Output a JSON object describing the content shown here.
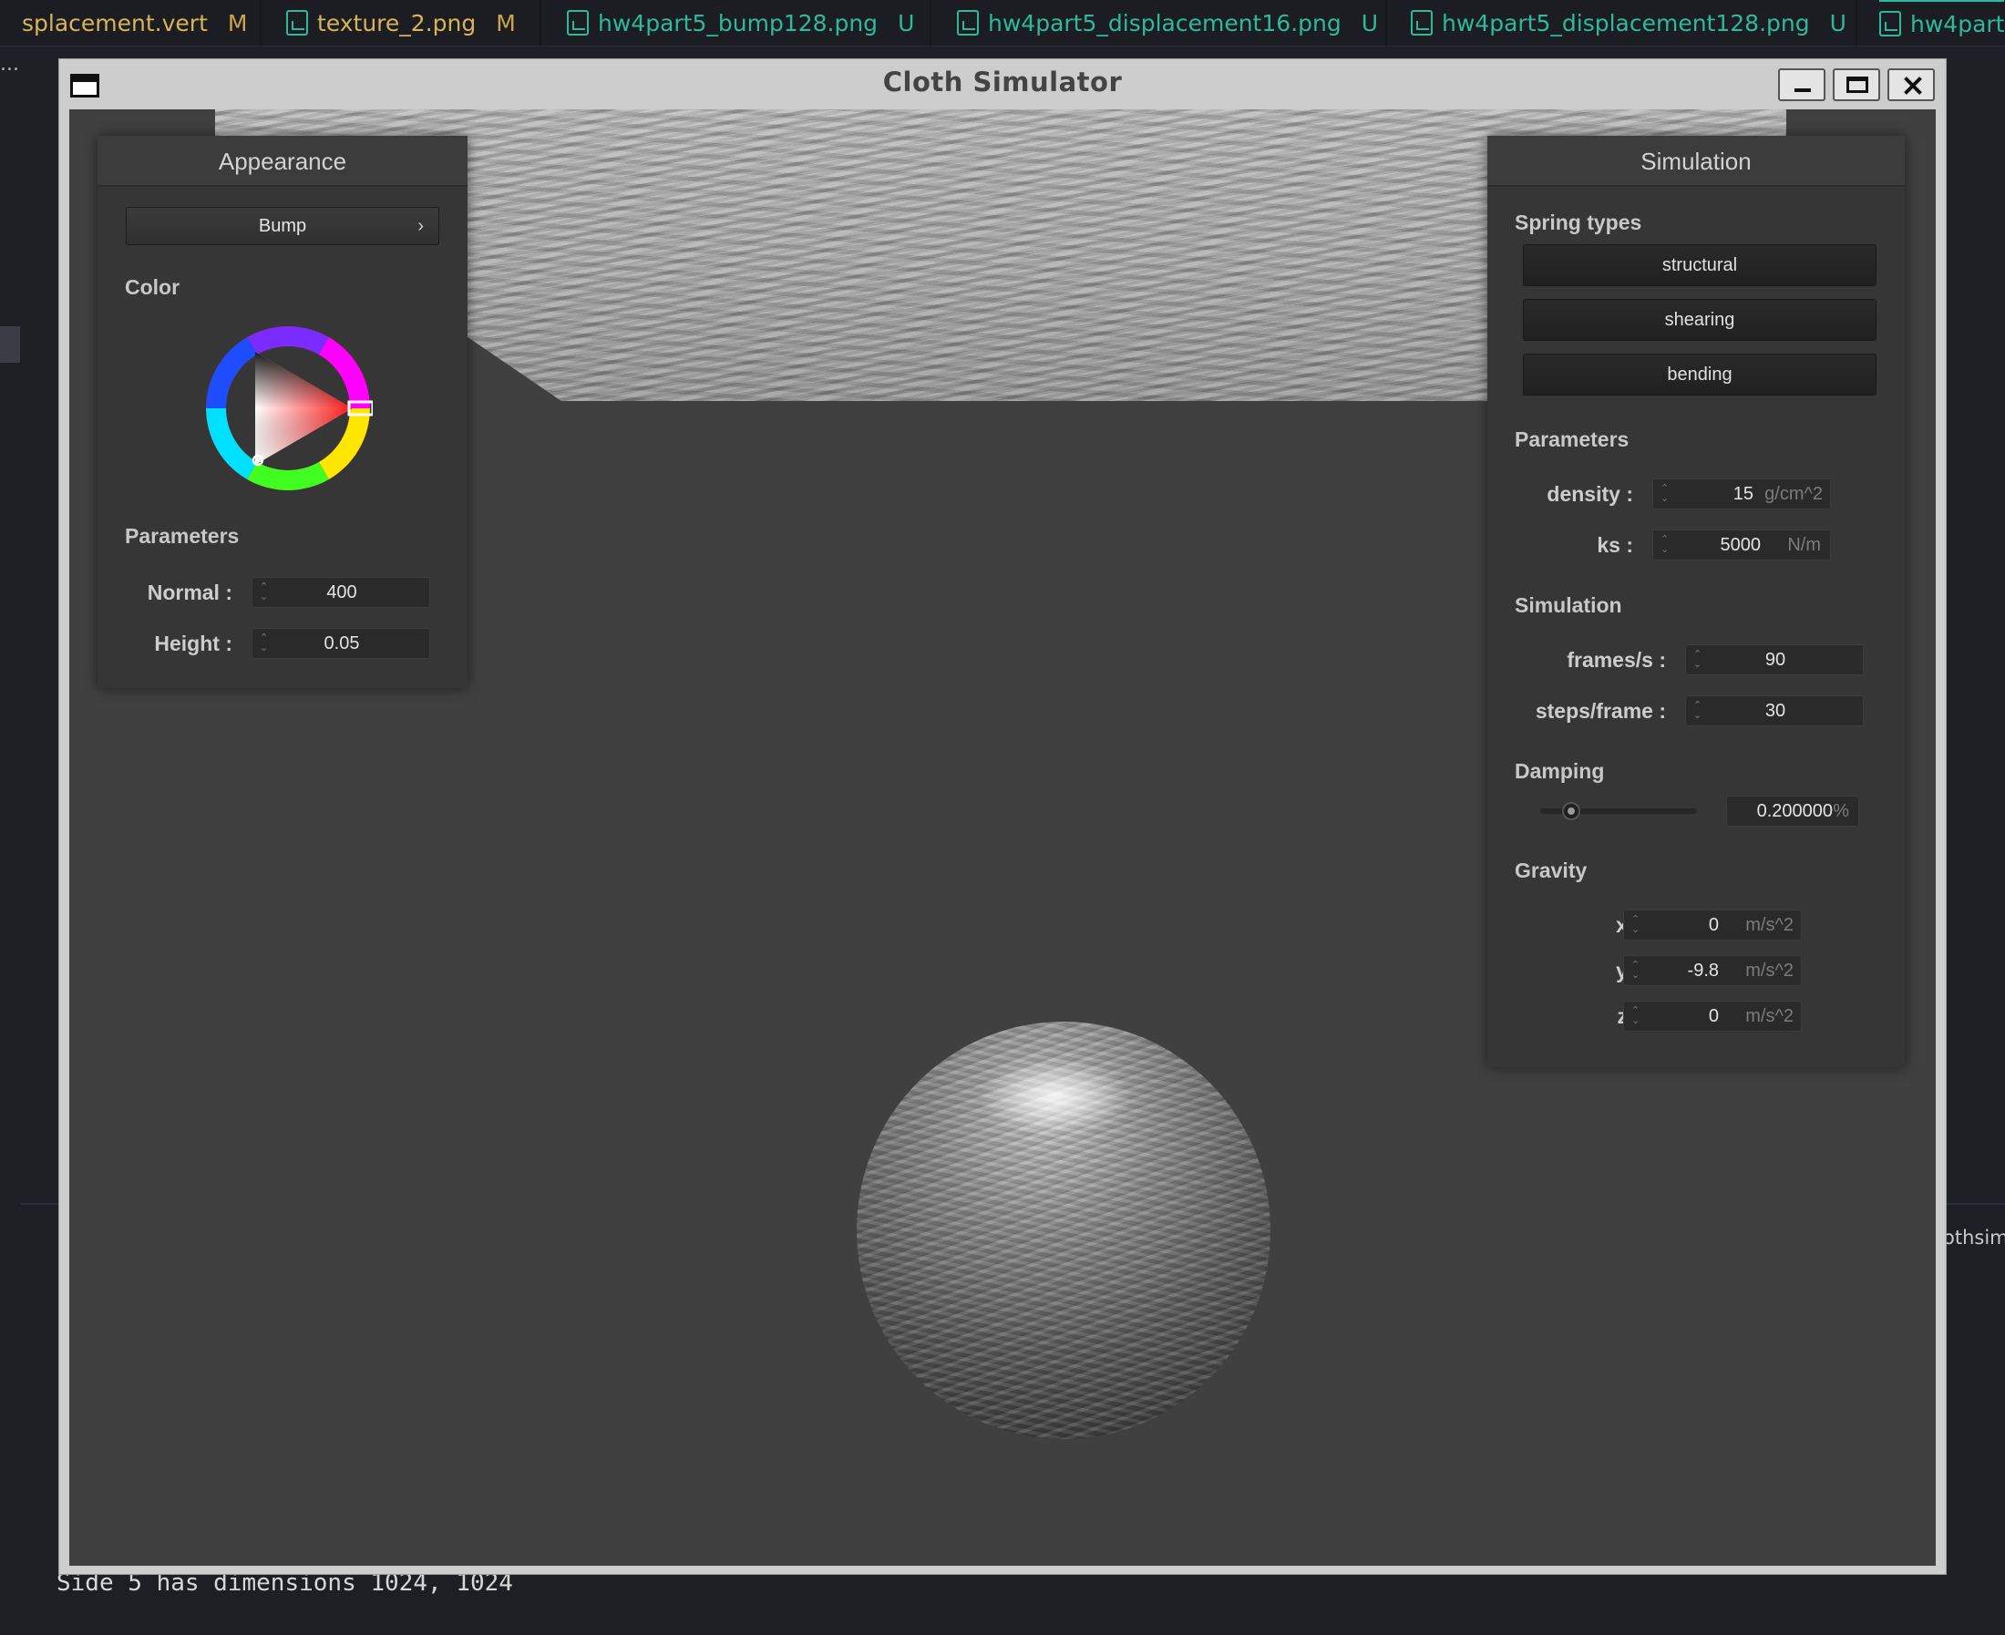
{
  "editor": {
    "tabs": [
      {
        "label": "splacement.vert",
        "status": "M",
        "type": "text"
      },
      {
        "label": "texture_2.png",
        "status": "M",
        "type": "image"
      },
      {
        "label": "hw4part5_bump128.png",
        "status": "U",
        "type": "image"
      },
      {
        "label": "hw4part5_displacement16.png",
        "status": "U",
        "type": "image"
      },
      {
        "label": "hw4part5_displacement128.png",
        "status": "U",
        "type": "image"
      },
      {
        "label": "hw4part",
        "status": "",
        "type": "image"
      }
    ],
    "overflow_label": "...",
    "side_text": "othsim",
    "terminal_lines": [
      "Side 5 has dimensions 1024, 1024"
    ]
  },
  "window": {
    "title": "Cloth Simulator"
  },
  "appearance": {
    "header": "Appearance",
    "shader_button": "Bump",
    "color_label": "Color",
    "params_label": "Parameters",
    "normal_label": "Normal :",
    "normal_value": "400",
    "height_label": "Height :",
    "height_value": "0.05",
    "color_selected": "#ff2020"
  },
  "simulation": {
    "header": "Simulation",
    "spring_types_label": "Spring types",
    "spring_types": [
      "structural",
      "shearing",
      "bending"
    ],
    "params_label": "Parameters",
    "density_label": "density :",
    "density_value": "15",
    "density_unit": "g/cm^2",
    "ks_label": "ks :",
    "ks_value": "5000",
    "ks_unit": "N/m",
    "simulation_label": "Simulation",
    "fps_label": "frames/s :",
    "fps_value": "90",
    "steps_label": "steps/frame :",
    "steps_value": "30",
    "damping_label": "Damping",
    "damping_value": "0.200000",
    "damping_unit": "%",
    "damping_fraction": 0.2,
    "gravity_label": "Gravity",
    "gx_label": "x :",
    "gx_value": "0",
    "gy_label": "y :",
    "gy_value": "-9.8",
    "gz_label": "z :",
    "gz_value": "0",
    "gravity_unit": "m/s^2"
  }
}
